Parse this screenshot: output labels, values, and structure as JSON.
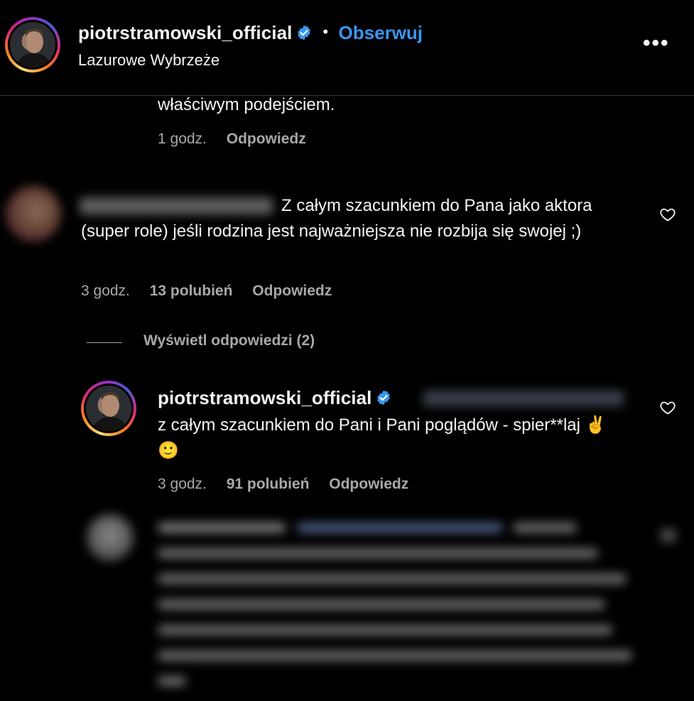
{
  "header": {
    "username": "piotrstramowski_official",
    "follow_label": "Obserwuj",
    "separator": "•",
    "location": "Lazurowe Wybrzeże",
    "more_label": "•••"
  },
  "comments": {
    "partial": {
      "text_tail": "właściwym podejściem.",
      "time": "1 godz.",
      "reply": "Odpowiedz"
    },
    "first": {
      "text": "Z całym szacunkiem do Pana jako aktora (super role) jeśli rodzina jest najważniejsza nie rozbija się swojej ;)",
      "time": "3 godz.",
      "likes": "13 polubień",
      "reply": "Odpowiedz",
      "view_replies": "Wyświetl odpowiedzi (2)"
    },
    "reply": {
      "username": "piotrstramowski_official",
      "text": "z całym szacunkiem do Pani i Pani poglądów - spier**laj ✌️🙂",
      "time": "3 godz.",
      "likes": "91 polubień",
      "reply": "Odpowiedz"
    }
  },
  "colors": {
    "accent": "#3797f0",
    "muted": "#a8a8a8",
    "background": "#000000"
  },
  "icons": [
    "verified-badge-icon",
    "heart-icon",
    "more-options-icon"
  ]
}
